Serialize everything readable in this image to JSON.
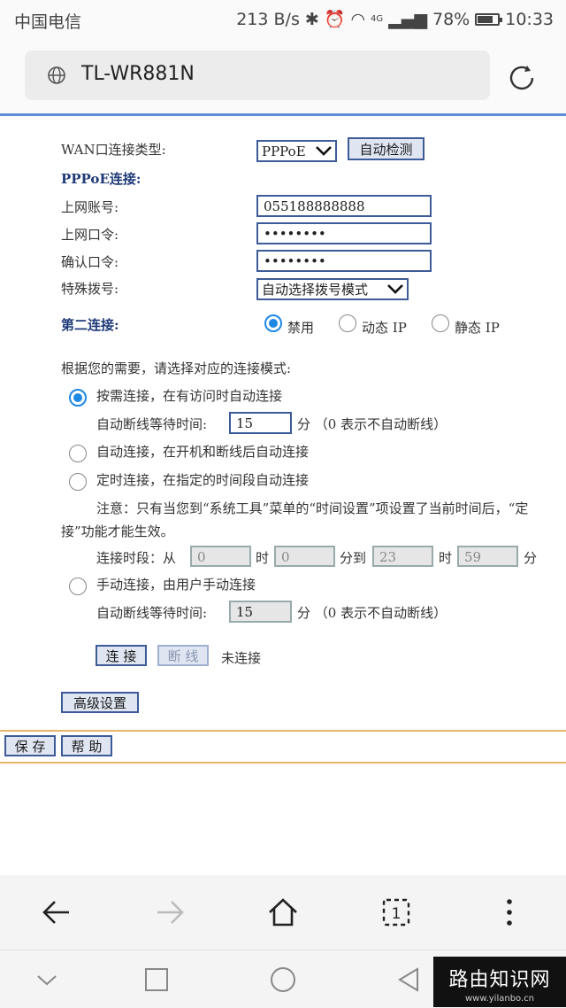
{
  "status_bar": {
    "carrier": "中国电信",
    "speed": "213 B/s",
    "network": "4G",
    "battery": "78%",
    "time": "10:33"
  },
  "browser": {
    "url": "TL-WR881N"
  },
  "wan": {
    "type_label": "WAN口连接类型:",
    "type_value": "PPPoE",
    "detect_button": "自动检测",
    "pppoe_header": "PPPoE连接:",
    "account_label": "上网账号:",
    "account_value": "055188888888",
    "password_label": "上网口令:",
    "password_value": "••••••••",
    "confirm_label": "确认口令:",
    "confirm_value": "••••••••",
    "dial_label": "特殊拨号:",
    "dial_value": "自动选择拨号模式",
    "second_label": "第二连接:",
    "second_options": [
      "禁用",
      "动态 IP",
      "静态 IP"
    ]
  },
  "mode": {
    "prompt": "根据您的需要，请选择对应的连接模式:",
    "on_demand": "按需连接，在有访问时自动连接",
    "idle_label": "自动断线等待时间:",
    "idle_value": "15",
    "idle_unit": "分 （0 表示不自动断线）",
    "auto": "自动连接，在开机和断线后自动连接",
    "timed": "定时连接，在指定的时间段自动连接",
    "note_line1": "注意：只有当您到“系统工具”菜单的“时间设置”项设置了当前时间后，“定",
    "note_line2": "接”功能才能生效。",
    "period_label": "连接时段：从",
    "from_h": "0",
    "h1": "时",
    "from_m": "0",
    "to_label": "分到",
    "to_h": "23",
    "h2": "时",
    "to_m": "59",
    "m2": "分",
    "manual": "手动连接，由用户手动连接",
    "idle2_label": "自动断线等待时间:",
    "idle2_value": "15",
    "idle2_unit": "分 （0 表示不自动断线）"
  },
  "actions": {
    "connect": "连 接",
    "disconnect": "断 线",
    "status": "未连接",
    "advanced": "高级设置",
    "save": "保 存",
    "help": "帮 助"
  },
  "watermark": {
    "title": "路由知识网",
    "site": "www.yilanbo.cn"
  }
}
